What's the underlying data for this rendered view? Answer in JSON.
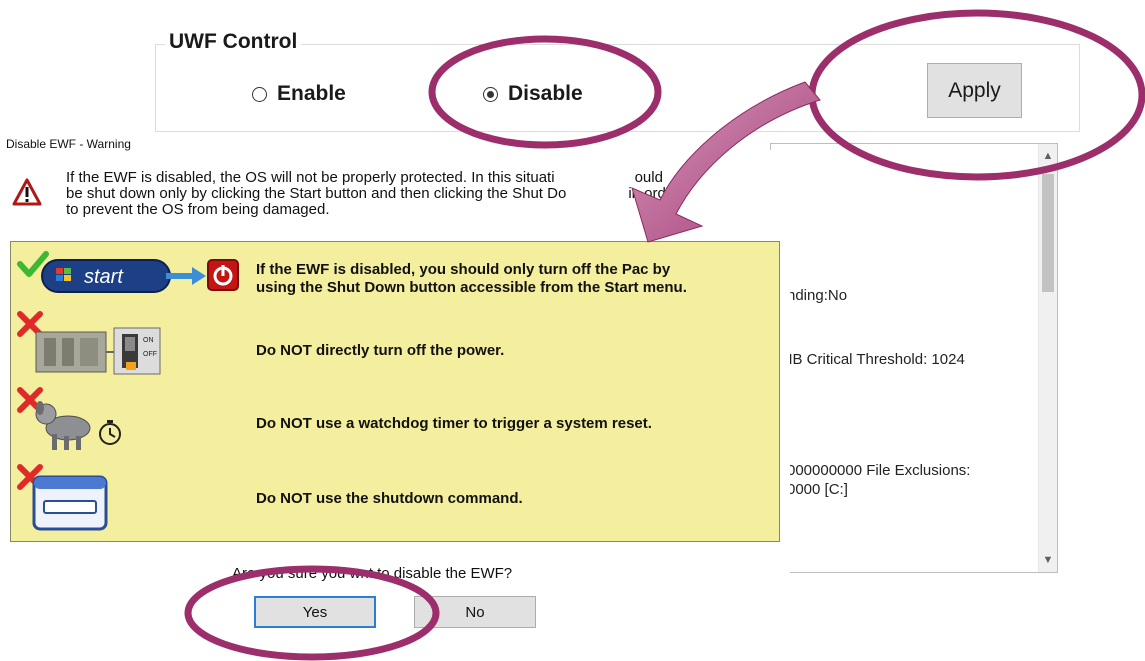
{
  "uwf": {
    "title": "UWF Control",
    "enable_label": "Enable",
    "disable_label": "Disable",
    "selected": "disable",
    "apply_label": "Apply"
  },
  "background_list": {
    "lines": [
      "nding:No",
      "MB   Critical Threshold: 1024",
      "000000000    File Exclusions:",
      "0000 [C:]"
    ]
  },
  "dialog": {
    "title": "Disable EWF - Warning",
    "warning_lines": [
      "If the EWF is disabled, the OS will not be properly protected. In this situati",
      "ould",
      "be shut down only by clicking the Start button and then clicking the Shut Do",
      "in order",
      "to prevent the OS from being damaged."
    ],
    "start_label": "start",
    "panel_rows": [
      {
        "text_1": "If the EWF is disabled, you should only turn off the Pac by",
        "text_2": "using the Shut Down button accessible from the Start menu."
      },
      {
        "text_1": "Do NOT directly turn off the power."
      },
      {
        "text_1": "Do NOT use a watchdog timer to trigger a system reset."
      },
      {
        "text_1": "Do NOT use the shutdown command."
      }
    ],
    "switch_on": "ON",
    "switch_off": "OFF",
    "confirm_visible_1": "A",
    "confirm_visible_2": "re you sure you w",
    "confirm_visible_3": "nt to disable the EWF?",
    "yes_label": "Yes",
    "no_label": "No"
  },
  "colors": {
    "annotation": "#9c2f6b",
    "panel_bg": "#f4ef9e",
    "focus_border": "#2a7fd4"
  }
}
